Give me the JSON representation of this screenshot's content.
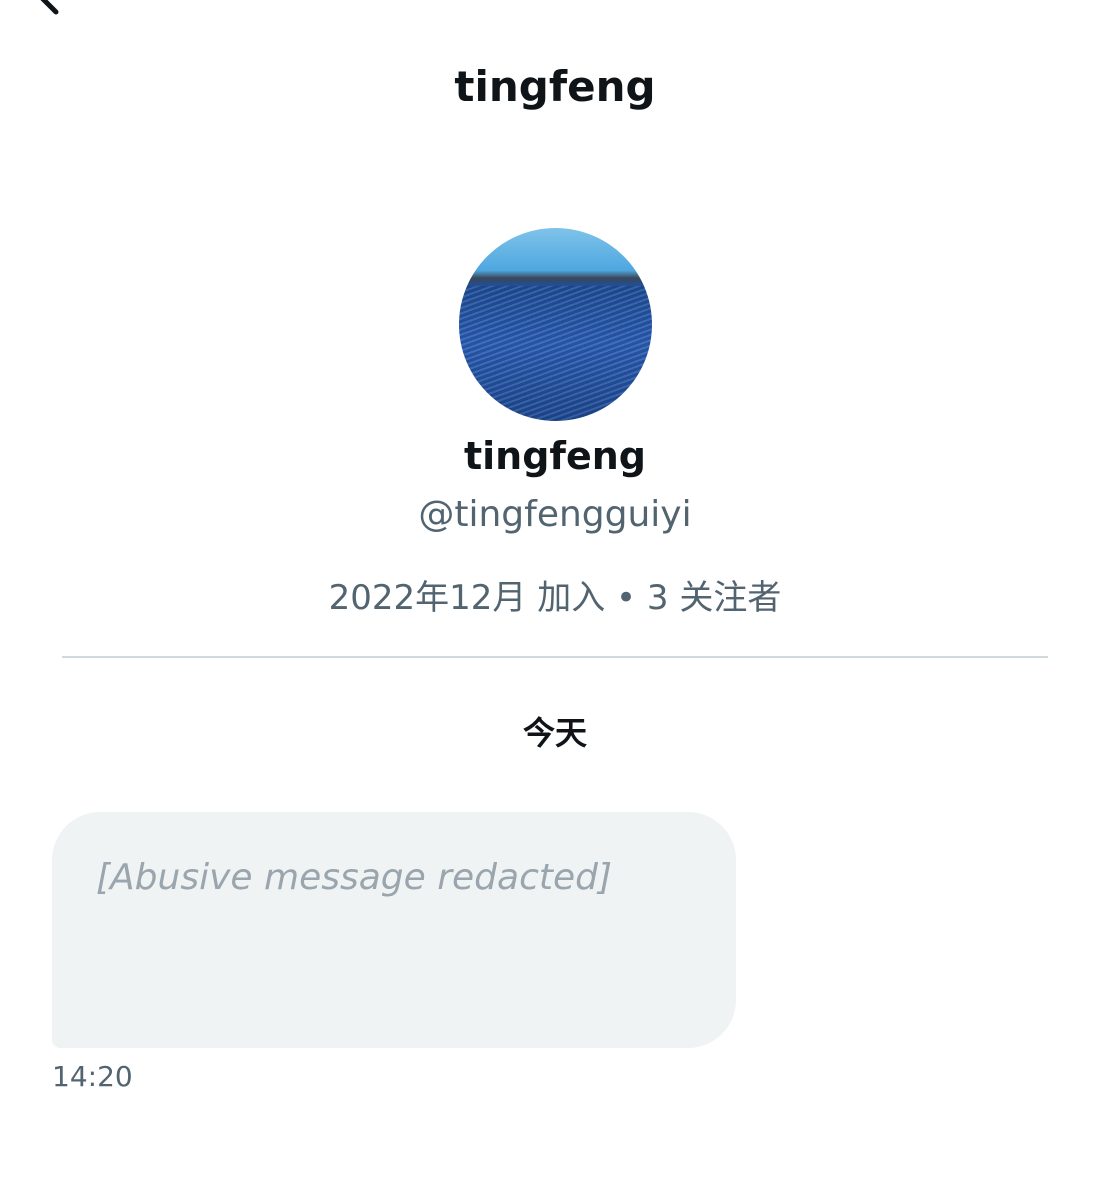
{
  "header": {
    "title": "tingfeng",
    "back_icon": "arrow-left-icon"
  },
  "profile": {
    "name": "tingfeng",
    "handle": "@tingfengguiyi",
    "meta": "2022年12月 加入 • 3 关注者"
  },
  "conversation": {
    "date_label": "今天",
    "messages": [
      {
        "text": "[Abusive message redacted]",
        "time": "14:20"
      }
    ]
  }
}
